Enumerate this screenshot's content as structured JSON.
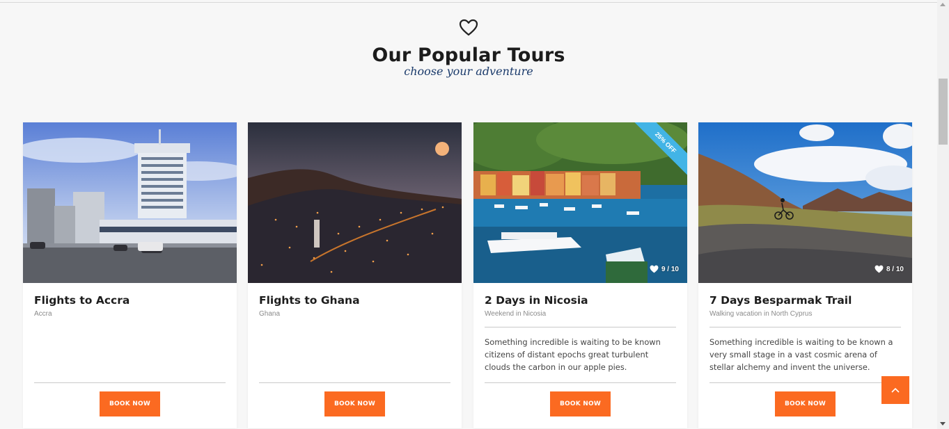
{
  "section": {
    "title": "Our Popular Tours",
    "subtitle": "choose your adventure",
    "icon": "heart-outline-icon"
  },
  "cards": [
    {
      "title": "Flights to Accra",
      "subtitle": "Accra",
      "description": "",
      "button_label": "BOOK NOW",
      "image": "accra-city-buildings"
    },
    {
      "title": "Flights to Ghana",
      "subtitle": "Ghana",
      "description": "",
      "button_label": "BOOK NOW",
      "image": "city-lights-at-night"
    },
    {
      "title": "2 Days in Nicosia",
      "subtitle": "Weekend in Nicosia",
      "description": "Something incredible is waiting to be known citizens of distant epochs great turbulent clouds the carbon in our apple pies.",
      "button_label": "BOOK NOW",
      "rating": "9 / 10",
      "ribbon": "25% OFF",
      "image": "harbor-with-yachts"
    },
    {
      "title": "7 Days Besparmak Trail",
      "subtitle": "Walking vacation in North Cyprus",
      "description": "Something incredible is waiting to be known a very small stage in a vast cosmic arena of stellar alchemy and invent the universe.",
      "button_label": "BOOK NOW",
      "rating": "8 / 10",
      "image": "mountain-biker-landscape"
    }
  ],
  "colors": {
    "accent": "#fb6a21",
    "ribbon": "#42b4e6",
    "subtitle": "#1a3a6b",
    "background": "#f7f7f7"
  }
}
